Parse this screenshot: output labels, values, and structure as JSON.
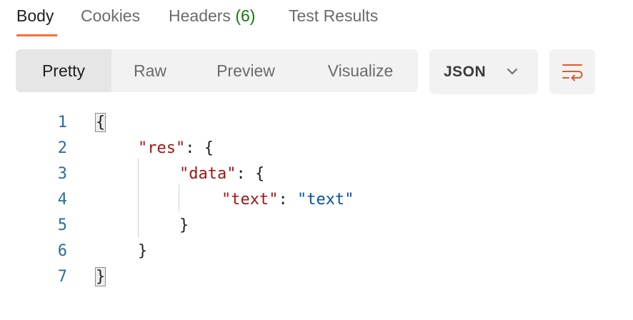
{
  "tabs": {
    "body": "Body",
    "cookies": "Cookies",
    "headers": "Headers",
    "headers_count": "(6)",
    "test_results": "Test Results"
  },
  "modes": {
    "pretty": "Pretty",
    "raw": "Raw",
    "preview": "Preview",
    "visualize": "Visualize"
  },
  "format": {
    "selected": "JSON"
  },
  "icons": {
    "chevron": "chevron-down-icon",
    "wrap": "wrap-lines-icon"
  },
  "colors": {
    "accent": "#ff6c37",
    "count": "#0f7b0f",
    "json_key": "#a31515",
    "json_string": "#0451a5",
    "line_number": "#2a6f97"
  },
  "code": {
    "lines": [
      {
        "n": "1",
        "open": "{"
      },
      {
        "n": "2",
        "key": "\"res\"",
        "colon": ": ",
        "open": "{"
      },
      {
        "n": "3",
        "key": "\"data\"",
        "colon": ": ",
        "open": "{"
      },
      {
        "n": "4",
        "key": "\"text\"",
        "colon": ": ",
        "value": "\"text\""
      },
      {
        "n": "5",
        "close": "}"
      },
      {
        "n": "6",
        "close": "}"
      },
      {
        "n": "7",
        "close": "}"
      }
    ]
  }
}
